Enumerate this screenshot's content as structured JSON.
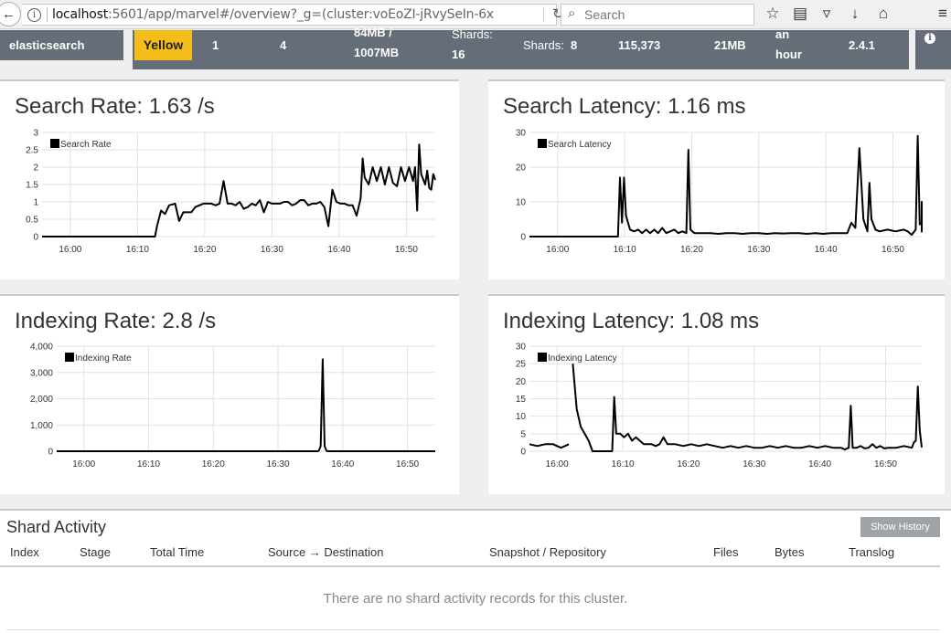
{
  "browser": {
    "url_host": "localhost",
    "url_path": ":5601/app/marvel#/overview?_g=(cluster:voEoZI-jRvySeIn-6x",
    "search_placeholder": "Search",
    "back_glyph": "←",
    "info_glyph": "i",
    "reload_glyph": "↻",
    "search_glyph": "⌕",
    "toolbar_icons": [
      "star-icon",
      "reading-list-icon",
      "pocket-icon",
      "download-icon",
      "home-icon",
      "menu-icon"
    ],
    "toolbar_glyphs": [
      "☆",
      "▤",
      "▿",
      "↓",
      "⌂",
      "≡"
    ]
  },
  "status_bar": {
    "cluster_name": "elasticsearch",
    "status": "Yellow",
    "nodes": "1",
    "indices": "4",
    "memory_line1": "84MB /",
    "memory_line2": "1007MB",
    "shards_label": "Shards:",
    "shards_value": "16",
    "unassigned_label": "Shards:",
    "unassigned_value": "8",
    "documents": "115,373",
    "data_size": "21MB",
    "uptime_line1": "an",
    "uptime_line2": "hour",
    "version": "2.4.1",
    "info_glyph": "i",
    "colors": {
      "bar": "#656d78",
      "yellow": "#f4bd19"
    }
  },
  "panels": {
    "search_rate": {
      "title": "Search Rate: 1.63 /s",
      "legend": "Search Rate"
    },
    "search_latency": {
      "title": "Search Latency: 1.16 ms",
      "legend": "Search Latency"
    },
    "indexing_rate": {
      "title": "Indexing Rate: 2.8 /s",
      "legend": "Indexing Rate"
    },
    "indexing_latency": {
      "title": "Indexing Latency: 1.08 ms",
      "legend": "Indexing Latency"
    }
  },
  "chart_data": [
    {
      "id": "search_rate",
      "type": "line",
      "legend": "Search Rate",
      "x_ticks": [
        "16:00",
        "16:10",
        "16:20",
        "16:30",
        "16:40",
        "16:50"
      ],
      "y_ticks": [
        "0",
        "0.5",
        "1",
        "1.5",
        "2",
        "2.5",
        "3"
      ],
      "xlim": [
        15.93,
        16.905
      ],
      "ylim": [
        0,
        3
      ],
      "grid": true,
      "legend_position": "top-left",
      "series": [
        {
          "values": [
            [
              15.93,
              0
            ],
            [
              16.08,
              0
            ],
            [
              16.2,
              0
            ],
            [
              16.21,
              0
            ],
            [
              16.215,
              0.3
            ],
            [
              16.225,
              0.75
            ],
            [
              16.235,
              0.65
            ],
            [
              16.245,
              0.9
            ],
            [
              16.26,
              0.95
            ],
            [
              16.27,
              0.45
            ],
            [
              16.28,
              0.7
            ],
            [
              16.3,
              0.7
            ],
            [
              16.31,
              0.85
            ],
            [
              16.33,
              0.95
            ],
            [
              16.35,
              0.95
            ],
            [
              16.36,
              0.9
            ],
            [
              16.37,
              0.95
            ],
            [
              16.38,
              1.6
            ],
            [
              16.39,
              0.95
            ],
            [
              16.4,
              0.95
            ],
            [
              16.41,
              0.9
            ],
            [
              16.42,
              1.0
            ],
            [
              16.43,
              0.8
            ],
            [
              16.44,
              0.85
            ],
            [
              16.45,
              0.95
            ],
            [
              16.46,
              0.9
            ],
            [
              16.47,
              1.05
            ],
            [
              16.48,
              0.7
            ],
            [
              16.49,
              1.0
            ],
            [
              16.5,
              0.95
            ],
            [
              16.52,
              0.95
            ],
            [
              16.53,
              1.0
            ],
            [
              16.54,
              1.0
            ],
            [
              16.55,
              0.9
            ],
            [
              16.56,
              0.95
            ],
            [
              16.57,
              1.05
            ],
            [
              16.58,
              1.05
            ],
            [
              16.59,
              0.9
            ],
            [
              16.6,
              0.95
            ],
            [
              16.61,
              0.95
            ],
            [
              16.62,
              1.0
            ],
            [
              16.63,
              0.85
            ],
            [
              16.64,
              0.3
            ],
            [
              16.65,
              1.35
            ],
            [
              16.66,
              1.0
            ],
            [
              16.67,
              0.95
            ],
            [
              16.68,
              0.95
            ],
            [
              16.69,
              0.9
            ],
            [
              16.7,
              0.9
            ],
            [
              16.71,
              0.6
            ],
            [
              16.72,
              1.1
            ],
            [
              16.725,
              2.25
            ],
            [
              16.73,
              1.7
            ],
            [
              16.74,
              1.5
            ],
            [
              16.75,
              2.0
            ],
            [
              16.76,
              1.6
            ],
            [
              16.77,
              2.0
            ],
            [
              16.78,
              1.5
            ],
            [
              16.79,
              2.0
            ],
            [
              16.8,
              1.55
            ],
            [
              16.81,
              1.45
            ],
            [
              16.82,
              2.0
            ],
            [
              16.83,
              1.6
            ],
            [
              16.84,
              2.0
            ],
            [
              16.85,
              1.6
            ],
            [
              16.855,
              2.0
            ],
            [
              16.86,
              0.75
            ],
            [
              16.865,
              2.65
            ],
            [
              16.87,
              1.8
            ],
            [
              16.88,
              1.5
            ],
            [
              16.885,
              1.9
            ],
            [
              16.89,
              1.4
            ],
            [
              16.895,
              1.35
            ],
            [
              16.9,
              1.8
            ],
            [
              16.905,
              1.63
            ]
          ]
        }
      ]
    },
    {
      "id": "search_latency",
      "type": "line",
      "legend": "Search Latency",
      "x_ticks": [
        "16:00",
        "16:10",
        "16:20",
        "16:30",
        "16:40",
        "16:50"
      ],
      "y_ticks": [
        "0",
        "10",
        "20",
        "30"
      ],
      "xlim": [
        15.93,
        16.905
      ],
      "ylim": [
        0,
        30
      ],
      "grid": true,
      "legend_position": "top-left",
      "series": [
        {
          "values": [
            [
              15.93,
              0
            ],
            [
              16.14,
              0
            ],
            [
              16.15,
              0
            ],
            [
              16.155,
              17
            ],
            [
              16.16,
              4
            ],
            [
              16.165,
              17
            ],
            [
              16.17,
              6
            ],
            [
              16.18,
              2
            ],
            [
              16.19,
              1.5
            ],
            [
              16.2,
              2
            ],
            [
              16.21,
              1
            ],
            [
              16.22,
              2
            ],
            [
              16.23,
              1
            ],
            [
              16.24,
              2
            ],
            [
              16.25,
              1
            ],
            [
              16.26,
              2.5
            ],
            [
              16.27,
              1
            ],
            [
              16.28,
              1.5
            ],
            [
              16.29,
              2
            ],
            [
              16.3,
              1
            ],
            [
              16.31,
              1.5
            ],
            [
              16.32,
              1
            ],
            [
              16.325,
              25
            ],
            [
              16.33,
              2
            ],
            [
              16.34,
              1
            ],
            [
              16.36,
              1
            ],
            [
              16.38,
              1
            ],
            [
              16.4,
              0.8
            ],
            [
              16.42,
              1
            ],
            [
              16.44,
              1
            ],
            [
              16.46,
              0.8
            ],
            [
              16.48,
              1
            ],
            [
              16.5,
              1
            ],
            [
              16.52,
              0.8
            ],
            [
              16.54,
              1
            ],
            [
              16.56,
              0.9
            ],
            [
              16.58,
              1
            ],
            [
              16.6,
              1
            ],
            [
              16.62,
              0.8
            ],
            [
              16.64,
              1
            ],
            [
              16.66,
              0.8
            ],
            [
              16.68,
              1
            ],
            [
              16.7,
              1
            ],
            [
              16.72,
              1
            ],
            [
              16.73,
              4
            ],
            [
              16.74,
              2.5
            ],
            [
              16.75,
              25.5
            ],
            [
              16.76,
              5
            ],
            [
              16.77,
              1.5
            ],
            [
              16.775,
              15.5
            ],
            [
              16.78,
              5
            ],
            [
              16.79,
              2
            ],
            [
              16.8,
              1.5
            ],
            [
              16.82,
              2
            ],
            [
              16.84,
              1.5
            ],
            [
              16.86,
              2
            ],
            [
              16.87,
              1.5
            ],
            [
              16.88,
              0.5
            ],
            [
              16.89,
              2
            ],
            [
              16.895,
              29
            ],
            [
              16.9,
              3.5
            ],
            [
              16.91,
              4
            ],
            [
              16.92,
              10
            ],
            [
              16.925,
              1.2
            ]
          ]
        }
      ]
    },
    {
      "id": "indexing_rate",
      "type": "line",
      "legend": "Indexing Rate",
      "x_ticks": [
        "16:00",
        "16:10",
        "16:20",
        "16:30",
        "16:40",
        "16:50"
      ],
      "y_ticks": [
        "0",
        "1,000",
        "2,000",
        "3,000",
        "4,000"
      ],
      "xlim": [
        15.93,
        16.905
      ],
      "ylim": [
        0,
        4000
      ],
      "grid": true,
      "legend_position": "top-left",
      "series": [
        {
          "values": [
            [
              15.93,
              0
            ],
            [
              16.6,
              0
            ],
            [
              16.605,
              10
            ],
            [
              16.61,
              200
            ],
            [
              16.615,
              3500
            ],
            [
              16.62,
              200
            ],
            [
              16.625,
              10
            ],
            [
              16.63,
              0
            ],
            [
              16.905,
              0
            ]
          ]
        }
      ]
    },
    {
      "id": "indexing_latency",
      "type": "line",
      "legend": "Indexing Latency",
      "x_ticks": [
        "16:00",
        "16:10",
        "16:20",
        "16:30",
        "16:40",
        "16:50"
      ],
      "y_ticks": [
        "0",
        "5",
        "10",
        "15",
        "20",
        "25",
        "30"
      ],
      "xlim": [
        15.93,
        16.925
      ],
      "ylim": [
        0,
        30
      ],
      "grid": true,
      "legend_position": "top-left",
      "series": [
        {
          "values": [
            [
              15.93,
              2
            ],
            [
              15.95,
              1.5
            ],
            [
              15.97,
              2
            ],
            [
              15.99,
              2
            ],
            [
              16.0,
              1.5
            ],
            [
              16.01,
              1
            ],
            [
              16.02,
              1.5
            ],
            [
              16.03,
              2
            ]
          ]
        },
        {
          "values": [
            [
              16.04,
              25
            ],
            [
              16.05,
              12
            ],
            [
              16.06,
              7
            ],
            [
              16.07,
              5
            ],
            [
              16.08,
              3
            ],
            [
              16.09,
              0
            ],
            [
              16.13,
              0
            ],
            [
              16.14,
              0
            ],
            [
              16.145,
              15.5
            ],
            [
              16.15,
              5
            ],
            [
              16.16,
              5
            ],
            [
              16.17,
              4
            ],
            [
              16.18,
              5
            ],
            [
              16.19,
              3
            ],
            [
              16.2,
              4
            ],
            [
              16.21,
              3
            ],
            [
              16.22,
              2
            ],
            [
              16.23,
              2
            ],
            [
              16.24,
              2
            ],
            [
              16.25,
              1.5
            ],
            [
              16.26,
              2
            ],
            [
              16.27,
              4
            ],
            [
              16.28,
              2
            ],
            [
              16.3,
              2
            ],
            [
              16.32,
              1.5
            ],
            [
              16.34,
              2
            ],
            [
              16.36,
              1.5
            ],
            [
              16.38,
              2
            ],
            [
              16.4,
              1.5
            ],
            [
              16.42,
              1
            ],
            [
              16.44,
              1.5
            ],
            [
              16.46,
              1
            ],
            [
              16.48,
              1.5
            ],
            [
              16.5,
              1
            ],
            [
              16.52,
              1
            ],
            [
              16.54,
              1.5
            ],
            [
              16.56,
              1
            ],
            [
              16.58,
              1.5
            ],
            [
              16.6,
              1
            ],
            [
              16.62,
              1
            ],
            [
              16.64,
              1.5
            ],
            [
              16.66,
              1
            ],
            [
              16.68,
              1.5
            ],
            [
              16.7,
              1
            ],
            [
              16.72,
              1
            ],
            [
              16.73,
              0.5
            ],
            [
              16.74,
              1
            ],
            [
              16.745,
              13
            ],
            [
              16.75,
              1
            ],
            [
              16.76,
              1
            ],
            [
              16.77,
              1.5
            ],
            [
              16.78,
              0.8
            ],
            [
              16.79,
              1
            ],
            [
              16.8,
              2
            ],
            [
              16.81,
              1
            ],
            [
              16.82,
              1.5
            ],
            [
              16.83,
              0.8
            ],
            [
              16.84,
              1
            ],
            [
              16.86,
              1
            ],
            [
              16.88,
              1.5
            ],
            [
              16.9,
              1
            ],
            [
              16.905,
              2.5
            ],
            [
              16.91,
              3
            ],
            [
              16.915,
              18.5
            ],
            [
              16.92,
              6
            ],
            [
              16.925,
              1.08
            ]
          ]
        }
      ]
    }
  ],
  "shard_activity": {
    "title": "Shard Activity",
    "show_history": "Show History",
    "columns": [
      "Index",
      "Stage",
      "Total Time",
      "Source → Destination",
      "Snapshot / Repository",
      "Files",
      "Bytes",
      "Translog"
    ],
    "empty_message": "There are no shard activity records for this cluster."
  }
}
